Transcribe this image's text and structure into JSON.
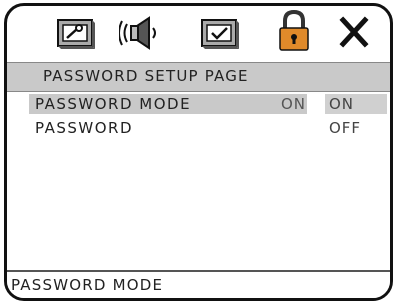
{
  "icons": [
    "wrench-tab-icon",
    "speaker-tab-icon",
    "checkbox-tab-icon",
    "lock-tab-icon",
    "close-icon"
  ],
  "title": "PASSWORD SETUP PAGE",
  "menu": {
    "items": [
      {
        "label": "PASSWORD MODE",
        "value": "ON"
      },
      {
        "label": "PASSWORD",
        "value": ""
      }
    ]
  },
  "options": [
    "ON",
    "OFF"
  ],
  "status": "PASSWORD MODE",
  "colors": {
    "highlight": "#c9c9c9",
    "border": "#111111"
  }
}
